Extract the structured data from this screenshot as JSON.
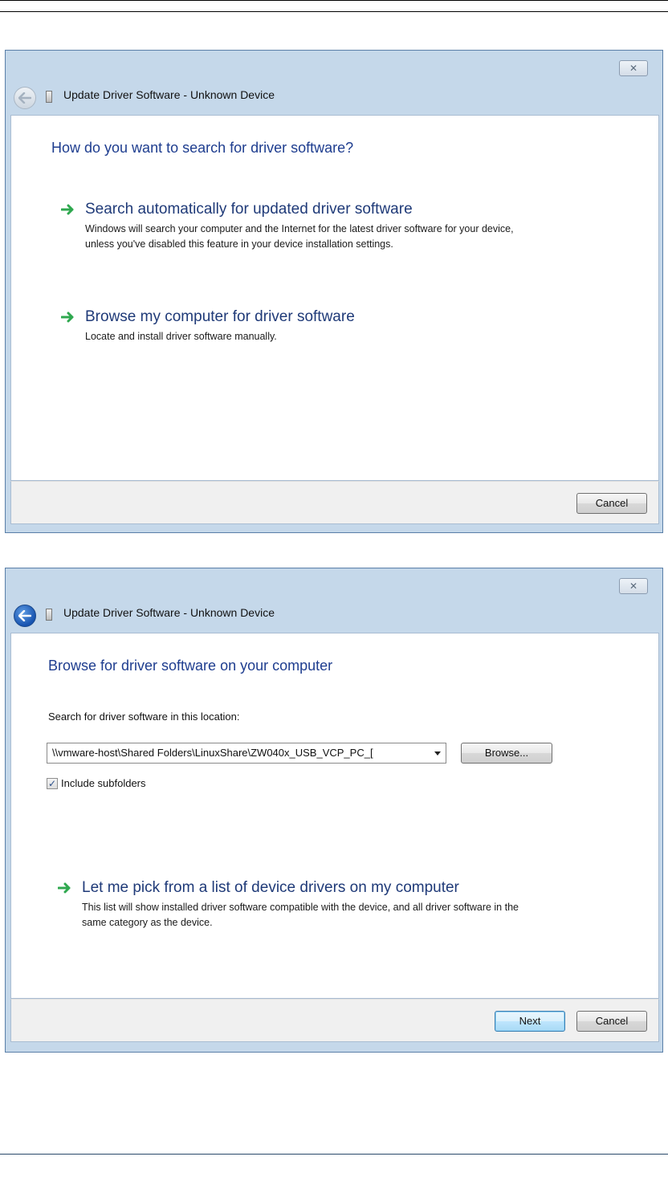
{
  "dialog1": {
    "close_glyph": "✕",
    "title": "Update Driver Software - Unknown Device",
    "heading": "How do you want to search for driver software?",
    "option1": {
      "title": "Search automatically for updated driver software",
      "desc": "Windows will search your computer and the Internet for the latest driver software for your device, unless you've disabled this feature in your device installation settings."
    },
    "option2": {
      "title": "Browse my computer for driver software",
      "desc": "Locate and install driver software manually."
    },
    "cancel_label": "Cancel"
  },
  "dialog2": {
    "close_glyph": "✕",
    "title": "Update Driver Software - Unknown Device",
    "heading": "Browse for driver software on your computer",
    "location_label": "Search for driver software in this location:",
    "location_value": "\\\\vmware-host\\Shared Folders\\LinuxShare\\ZW040x_USB_VCP_PC_[",
    "browse_label": "Browse...",
    "include_subfolders_label": "Include subfolders",
    "include_subfolders_checked": true,
    "checkbox_glyph": "✓",
    "option": {
      "title": "Let me pick from a list of device drivers on my computer",
      "desc": "This list will show installed driver software compatible with the device, and all driver software in the same category as the device."
    },
    "next_label": "Next",
    "cancel_label": "Cancel"
  },
  "icons": {
    "back": "back-arrow-icon",
    "option_arrow": "green-arrow-icon",
    "device": "device-icon"
  },
  "colors": {
    "heading": "#1e3d8f",
    "option_arrow": "#2fa84f",
    "window_frame": "#c5d8ea"
  }
}
